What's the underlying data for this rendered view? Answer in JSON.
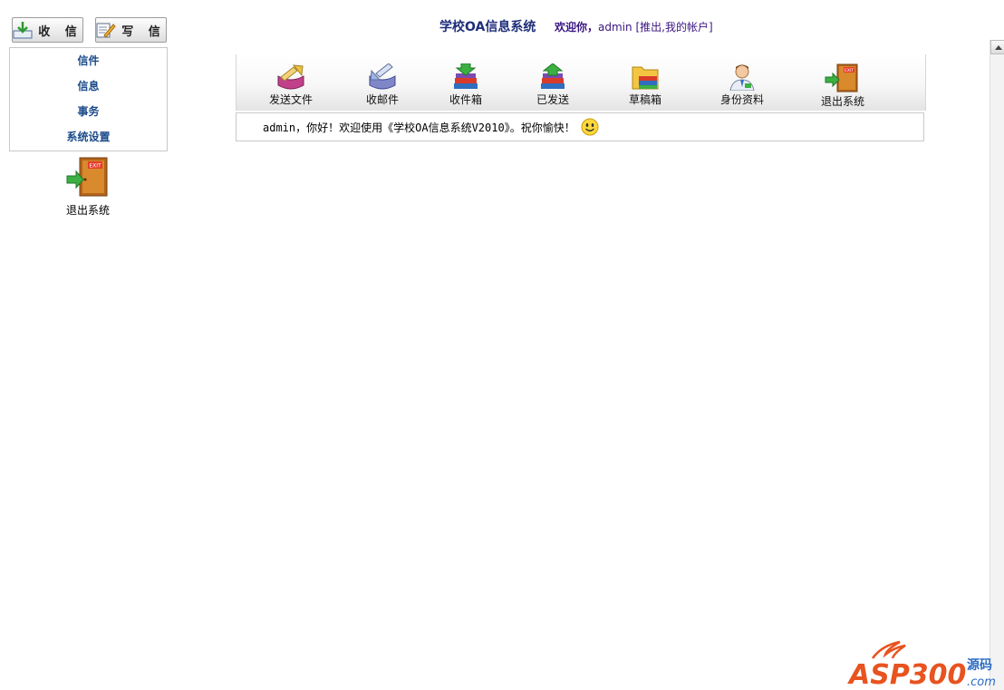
{
  "left": {
    "buttons": [
      {
        "label": "收 信",
        "icon": "inbox-download-icon"
      },
      {
        "label": "写 信",
        "icon": "compose-pencil-icon"
      }
    ],
    "menu": [
      "信件",
      "信息",
      "事务",
      "系统设置"
    ],
    "exit": {
      "label": "退出系统",
      "icon": "exit-door-icon"
    }
  },
  "header": {
    "title": "学校OA信息系统",
    "welcome_prefix": "欢迎你，",
    "user": "admin",
    "account_links": "[推出,我的帐户]"
  },
  "toolbar": {
    "items": [
      {
        "label": "发送文件",
        "icon": "send-file-icon"
      },
      {
        "label": "收邮件",
        "icon": "receive-mail-icon"
      },
      {
        "label": "收件箱",
        "icon": "inbox-books-icon"
      },
      {
        "label": "已发送",
        "icon": "sent-books-icon"
      },
      {
        "label": "草稿箱",
        "icon": "drafts-folder-icon"
      },
      {
        "label": "身份资料",
        "icon": "profile-person-icon"
      },
      {
        "label": "退出系统",
        "icon": "exit-door-icon"
      }
    ]
  },
  "welcome_message": "admin，你好！欢迎使用《学校OA信息系统V2010》。祝你愉快！",
  "watermark": {
    "brand": "ASP300",
    "suffix": "源码",
    "domain": ".com"
  },
  "colors": {
    "menu_text": "#1c4b8a",
    "title": "#1f2f7a",
    "welcome": "#3a1580",
    "watermark": "#e8531f"
  }
}
